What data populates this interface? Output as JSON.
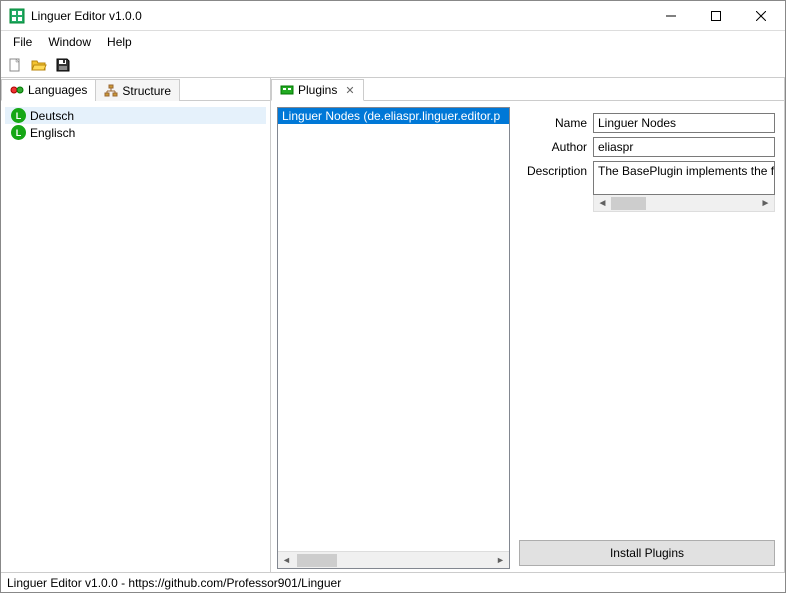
{
  "window": {
    "title": "Linguer Editor v1.0.0"
  },
  "menubar": {
    "file": "File",
    "window": "Window",
    "help": "Help"
  },
  "left": {
    "tabs": {
      "languages": "Languages",
      "structure": "Structure"
    },
    "langs": [
      {
        "label": "Deutsch"
      },
      {
        "label": "Englisch"
      }
    ]
  },
  "center": {
    "tab": "Plugins",
    "plugins": [
      {
        "label": "Linguer Nodes  (de.eliaspr.linguer.editor.p"
      }
    ]
  },
  "form": {
    "name_label": "Name",
    "name_value": "Linguer Nodes",
    "author_label": "Author",
    "author_value": "eliaspr",
    "description_label": "Description",
    "description_value": "The BasePlugin implements the fun"
  },
  "buttons": {
    "install": "Install Plugins"
  },
  "statusbar": {
    "text": "Linguer Editor v1.0.0  -  https://github.com/Professor901/Linguer"
  }
}
